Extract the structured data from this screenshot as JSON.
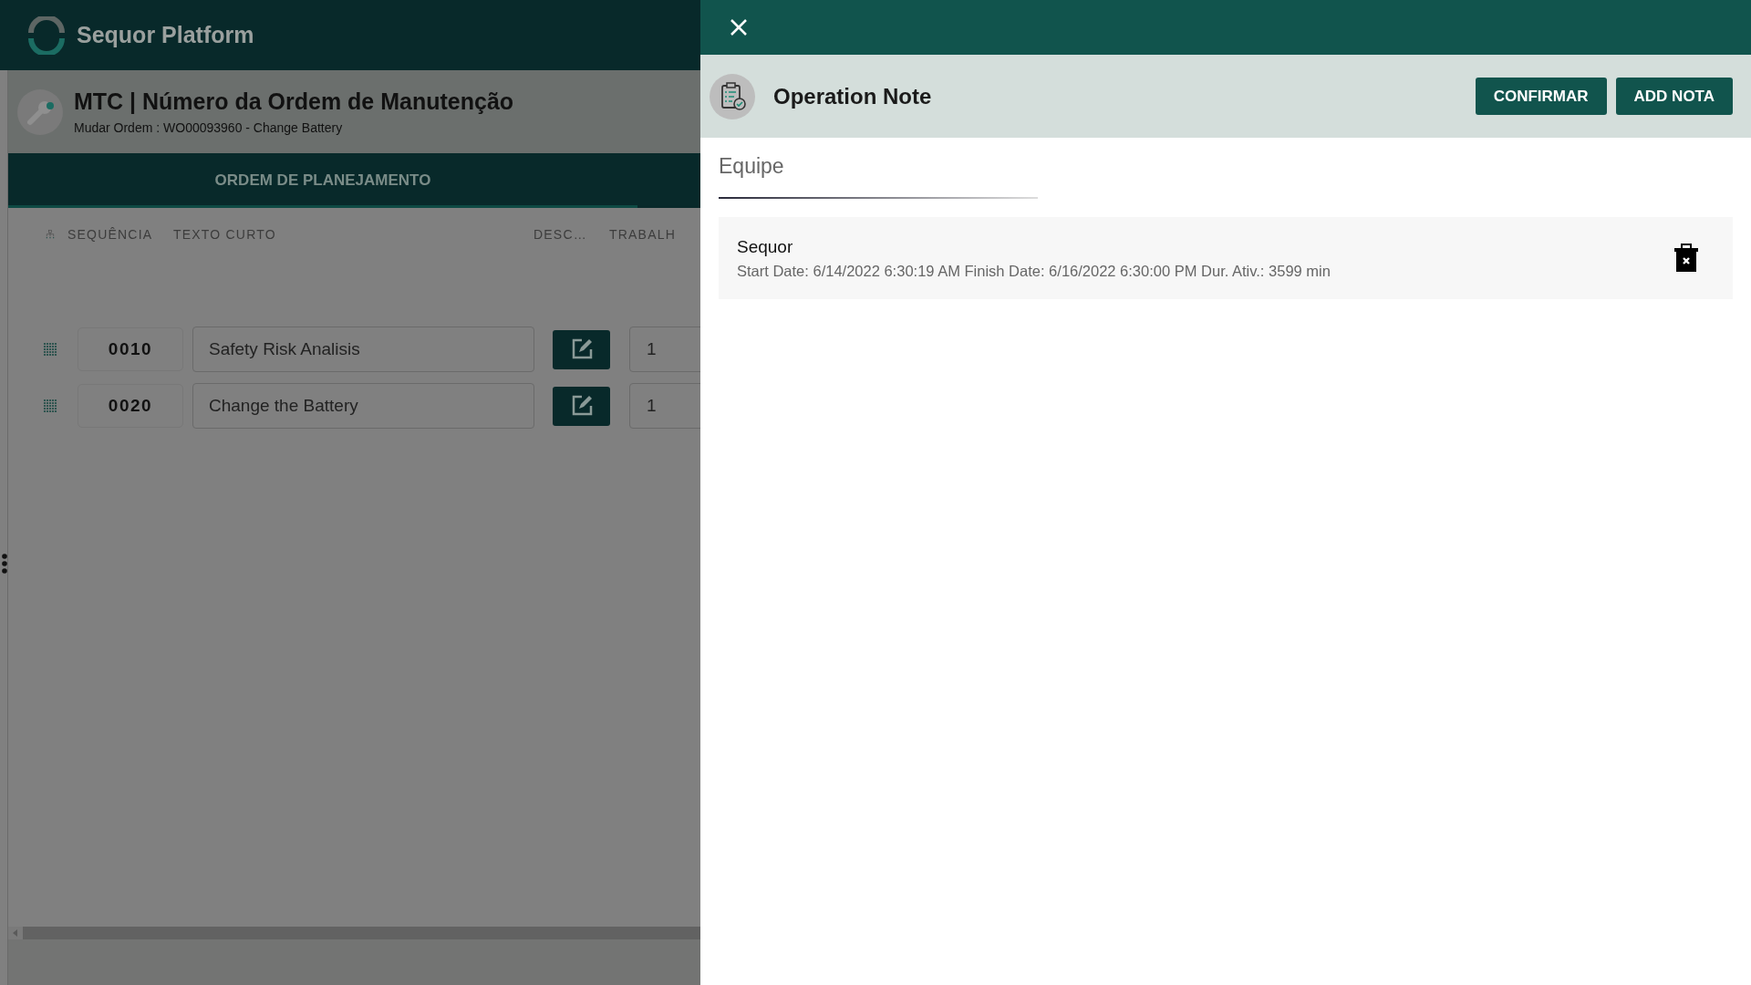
{
  "app": {
    "title": "Sequor Platform"
  },
  "order": {
    "title": "MTC | Número da Ordem de Manutenção",
    "subtitle": "Mudar Ordem : WO00093960 - Change Battery"
  },
  "tabs": [
    {
      "label": "ORDEM DE PLANEJAMENTO",
      "selected": true
    }
  ],
  "table": {
    "columns": [
      "SEQUÊNCIA",
      "TEXTO CURTO",
      "DESC…",
      "TRABALH"
    ],
    "rows": [
      {
        "sequence": "0010",
        "short_text": "Safety Risk Analisis",
        "column_4": "1"
      },
      {
        "sequence": "0020",
        "short_text": "Change the Battery",
        "column_4": "1"
      }
    ]
  },
  "panel": {
    "title": "Operation Note",
    "buttons": [
      "CONFIRMAR",
      "ADD NOTA"
    ],
    "section": "Equipe",
    "notes": [
      {
        "name": "Sequor",
        "details": "Start Date: 6/14/2022 6:30:19 AM Finish Date: 6/16/2022 6:30:00 PM Dur. Ativ.: 3599 min"
      }
    ]
  }
}
